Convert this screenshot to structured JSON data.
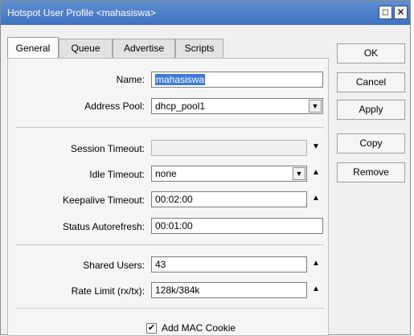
{
  "window": {
    "title": "Hotspot User Profile <mahasiswa>",
    "maximize_icon": "maximize-icon",
    "close_icon": "close-icon"
  },
  "tabs": [
    {
      "label": "General",
      "active": true
    },
    {
      "label": "Queue"
    },
    {
      "label": "Advertise"
    },
    {
      "label": "Scripts"
    }
  ],
  "form": {
    "name_label": "Name:",
    "name_value": "mahasiswa",
    "address_pool_label": "Address Pool:",
    "address_pool_value": "dhcp_pool1",
    "session_timeout_label": "Session Timeout:",
    "session_timeout_value": "",
    "idle_timeout_label": "Idle Timeout:",
    "idle_timeout_value": "none",
    "keepalive_timeout_label": "Keepalive Timeout:",
    "keepalive_timeout_value": "00:02:00",
    "status_autorefresh_label": "Status Autorefresh:",
    "status_autorefresh_value": "00:01:00",
    "shared_users_label": "Shared Users:",
    "shared_users_value": "43",
    "rate_limit_label": "Rate Limit (rx/tx):",
    "rate_limit_value": "128k/384k",
    "add_mac_cookie_label": "Add MAC Cookie",
    "add_mac_cookie_checked": true
  },
  "buttons": {
    "ok": "OK",
    "cancel": "Cancel",
    "apply": "Apply",
    "copy": "Copy",
    "remove": "Remove"
  },
  "glyphs": {
    "dropdown": "▼",
    "up": "▲",
    "down": "▼",
    "check": "✔",
    "combo": "▾"
  }
}
